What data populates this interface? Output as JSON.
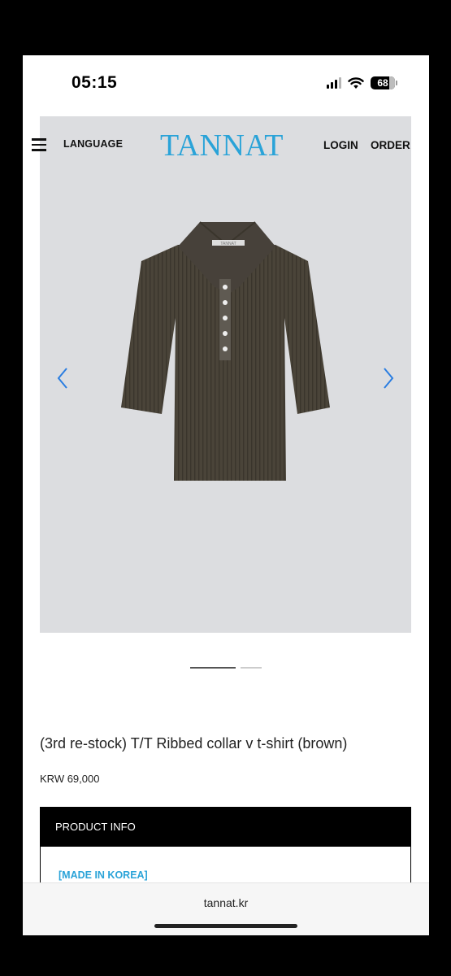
{
  "status": {
    "time": "05:15",
    "battery": "68"
  },
  "nav": {
    "language": "LANGUAGE",
    "logo": "TANNAT",
    "login": "LOGIN",
    "order": "ORDER"
  },
  "product": {
    "title": "(3rd re-stock) T/T Ribbed collar v t-shirt (brown)",
    "price": "KRW 69,000",
    "image_label": "TANNAT",
    "garment_color": "#4a4439"
  },
  "carousel": {
    "page": 1,
    "total": 2
  },
  "info": {
    "header": "PRODUCT INFO",
    "made_in": "[MADE IN KOREA]"
  },
  "browser": {
    "url": "tannat.kr"
  },
  "colors": {
    "accent": "#2aa3d8",
    "hero_bg": "#dcdde0"
  }
}
